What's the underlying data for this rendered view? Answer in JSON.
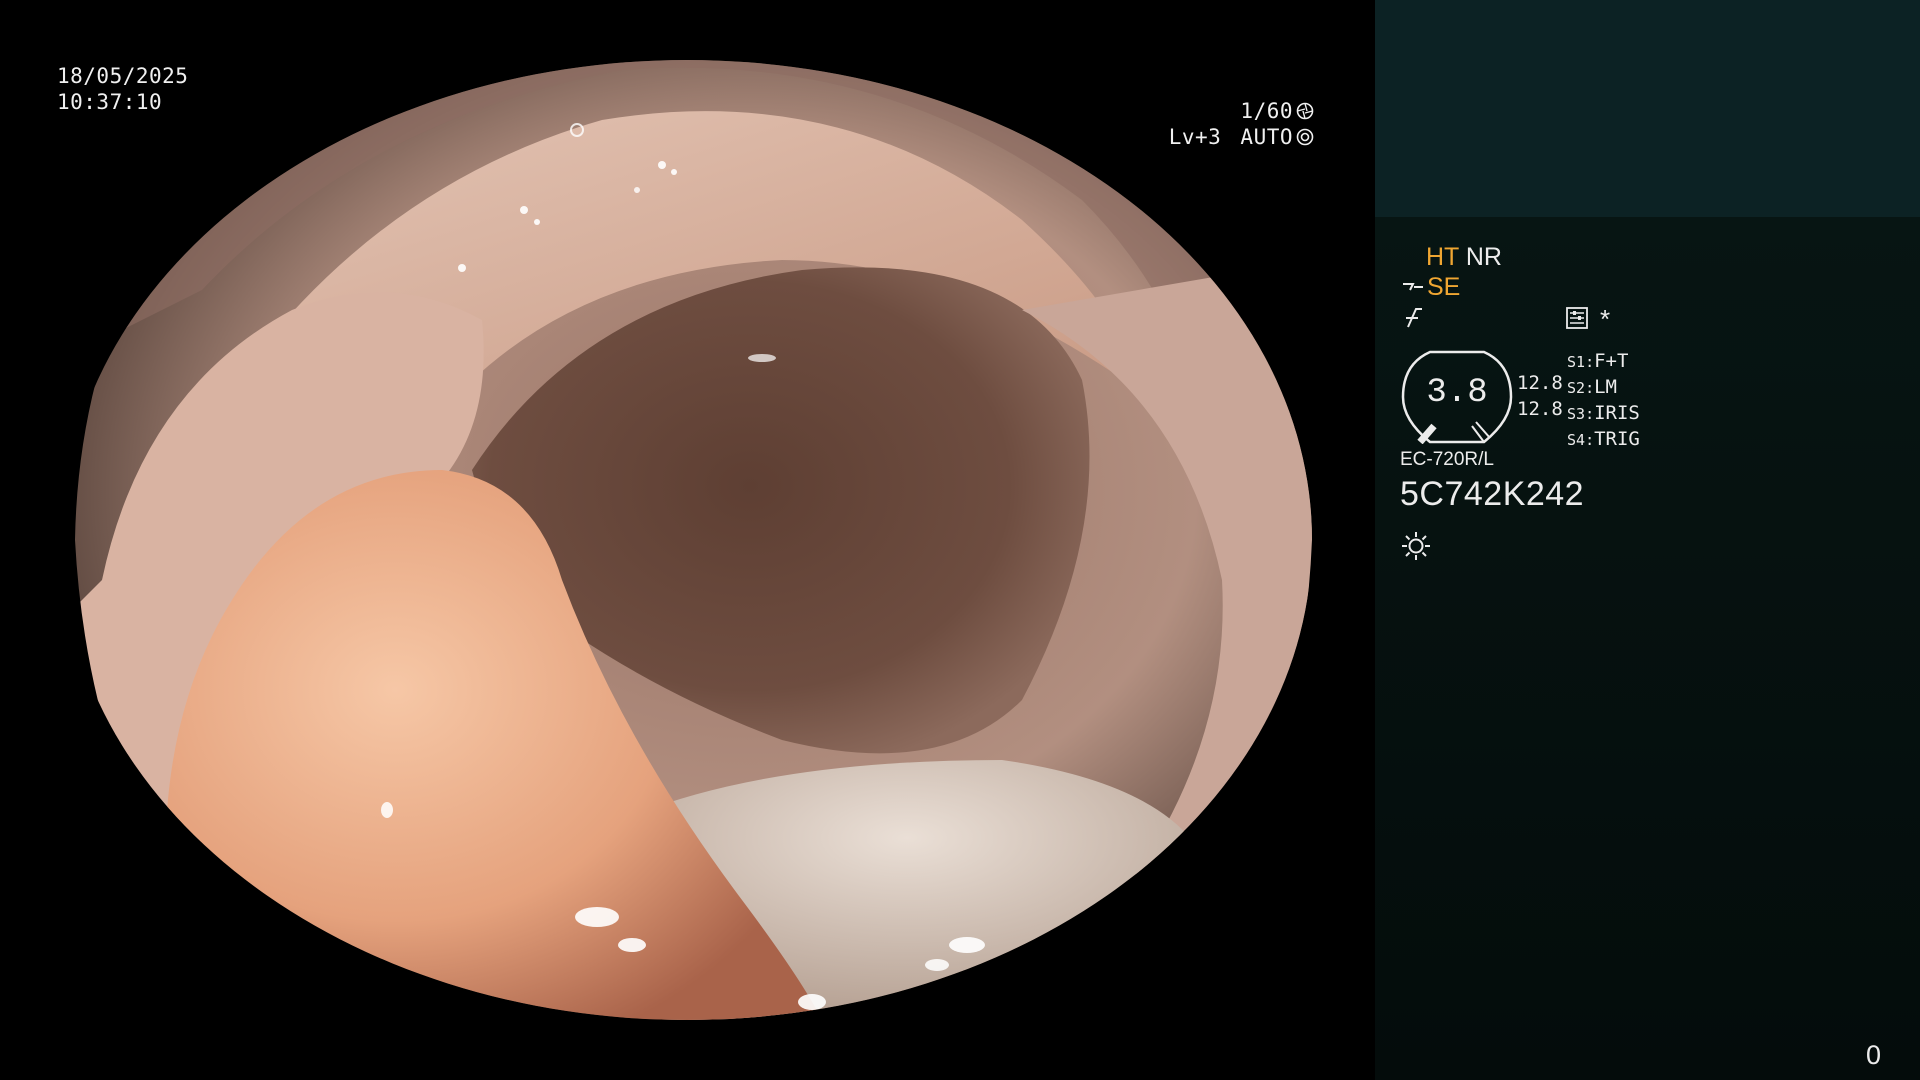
{
  "overlay": {
    "date": "18/05/2025",
    "time": "10:37:10",
    "shutter_speed": "1/60",
    "light_level": "Lv+3",
    "iris_mode": "AUTO"
  },
  "panel": {
    "ht_label": "HT",
    "nr_label": "NR",
    "se_label": "SE",
    "asterisk": "*",
    "gauge_value": "3.8",
    "side_value_1": "12.8",
    "side_value_2": "12.8",
    "switches": [
      {
        "key": "S1",
        "value": "F+T"
      },
      {
        "key": "S2",
        "value": "LM"
      },
      {
        "key": "S3",
        "value": "IRIS"
      },
      {
        "key": "S4",
        "value": "TRIG"
      }
    ],
    "scope_model": "EC-720R/L",
    "scope_serial": "5C742K242",
    "counter": "0"
  },
  "colors": {
    "accent_amber": "#f0a632",
    "panel_top": "#0c2224",
    "panel_main": "#071513"
  },
  "icons": [
    "shutter-icon",
    "iris-icon",
    "structure-enhance-icon",
    "enhancement-icon",
    "menu-icon",
    "brightness-sun-icon"
  ]
}
